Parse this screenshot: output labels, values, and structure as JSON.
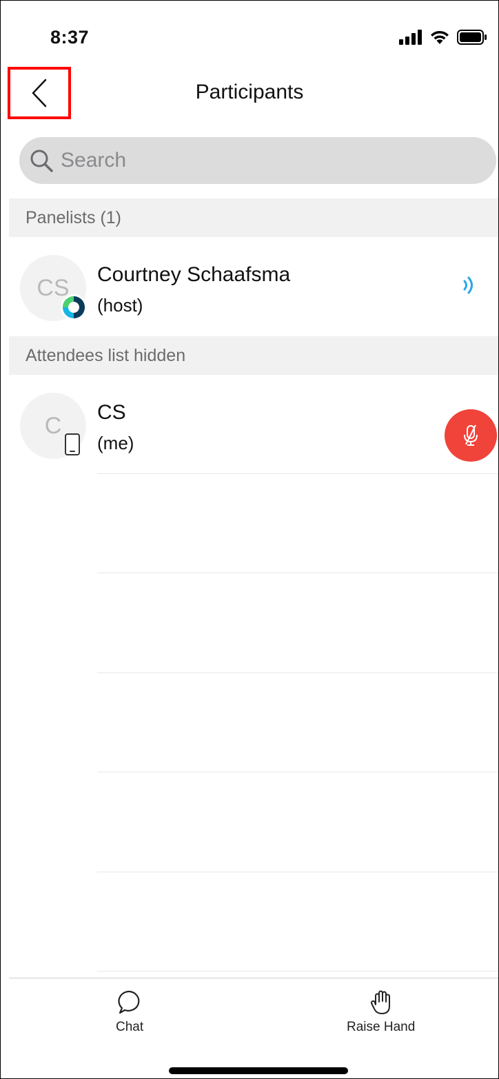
{
  "status_bar": {
    "time": "8:37"
  },
  "nav": {
    "title": "Participants",
    "back_icon": "chevron-left-icon"
  },
  "search": {
    "placeholder": "Search"
  },
  "sections": {
    "panelists_header": "Panelists (1)",
    "attendees_header": "Attendees list hidden"
  },
  "panelists": [
    {
      "initials": "CS",
      "name": "Courtney Schaafsma",
      "role": "(host)",
      "badge_icon": "webex-logo-icon",
      "status_icon": "speaking-icon"
    }
  ],
  "me": {
    "initials": "C",
    "name": "CS",
    "role": "(me)",
    "badge_icon": "phone-icon",
    "action_icon": "mic-muted-icon",
    "accent": "#f0433a"
  },
  "tabbar": {
    "chat_label": "Chat",
    "raise_hand_label": "Raise Hand"
  },
  "colors": {
    "speaking": "#2aa7e6",
    "mute_button": "#f0433a",
    "highlight_border": "#ff0000"
  }
}
